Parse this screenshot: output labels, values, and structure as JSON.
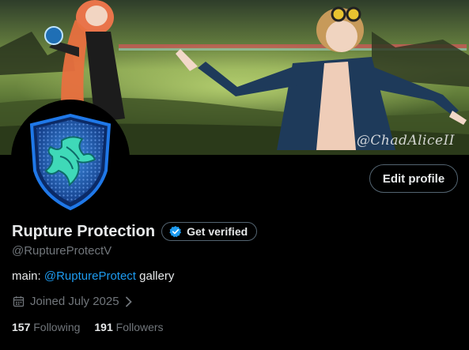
{
  "banner": {
    "watermark": "@ChadAliceII"
  },
  "profile": {
    "display_name": "Rupture Protection",
    "verify_label": "Get verified",
    "handle": "@RuptureProtectV",
    "bio_prefix": "main: ",
    "bio_mention": "@RuptureProtect",
    "bio_suffix": " gallery",
    "joined": "Joined July 2025",
    "following_count": "157",
    "following_label": "Following",
    "followers_count": "191",
    "followers_label": "Followers"
  },
  "actions": {
    "edit_profile": "Edit profile"
  },
  "icons": {
    "verified": "verified-badge-icon",
    "calendar": "calendar-icon",
    "chevron": "chevron-right-icon",
    "avatar": "shield-icon"
  },
  "colors": {
    "accent": "#1d9bf0",
    "muted": "#71767b",
    "text": "#e7e9ea",
    "bg": "#000000"
  }
}
